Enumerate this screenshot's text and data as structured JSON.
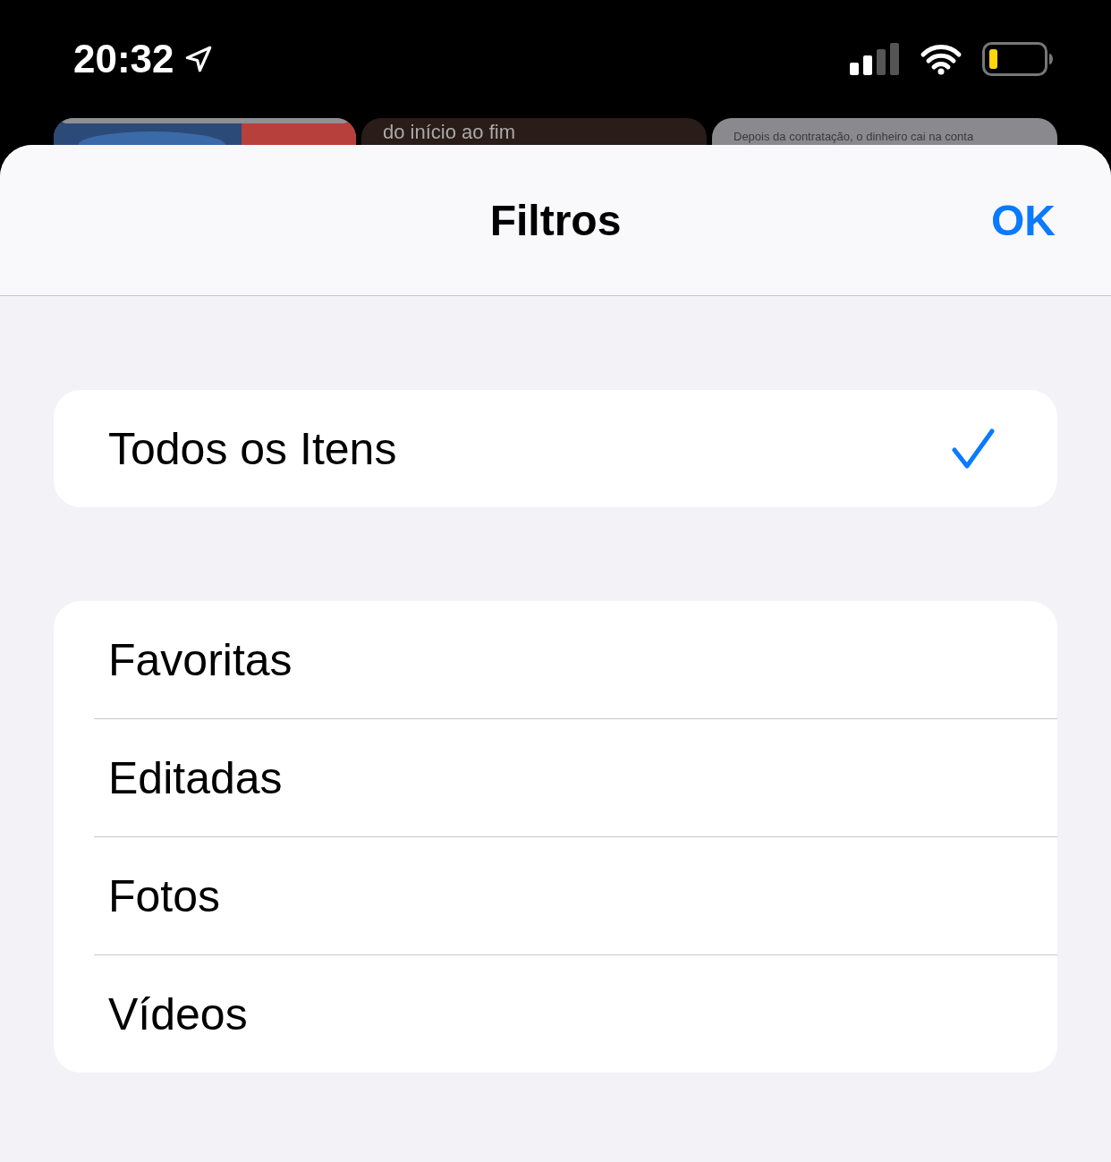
{
  "status_bar": {
    "time": "20:32"
  },
  "background_cards": [
    {
      "kind": "picture"
    },
    {
      "kind": "text",
      "text": "do início ao fim"
    },
    {
      "kind": "text",
      "text": "Depois da contratação, o dinheiro cai na conta"
    }
  ],
  "sheet": {
    "title": "Filtros",
    "done_button": "OK"
  },
  "groups": [
    [
      {
        "label": "Todos os Itens",
        "selected": true
      }
    ],
    [
      {
        "label": "Favoritas",
        "selected": false
      },
      {
        "label": "Editadas",
        "selected": false
      },
      {
        "label": "Fotos",
        "selected": false
      },
      {
        "label": "Vídeos",
        "selected": false
      }
    ]
  ]
}
